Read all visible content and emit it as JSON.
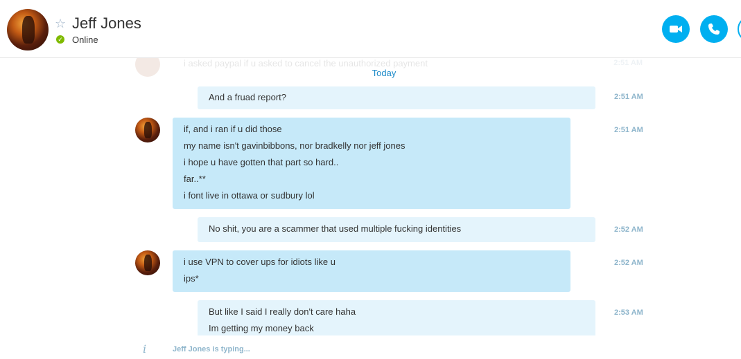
{
  "header": {
    "contact_name": "Jeff Jones",
    "status": "Online",
    "icons": {
      "favorite": "star-icon",
      "video": "video-call-icon",
      "audio": "phone-icon",
      "status": "check-icon"
    },
    "colors": {
      "accent": "#00aff0",
      "online": "#7fba00"
    }
  },
  "conversation": {
    "faded_message": {
      "text": "i asked paypal if u asked to cancel the unauthorized payment",
      "time": "2:51 AM"
    },
    "date_divider": "Today",
    "messages": [
      {
        "direction": "outgoing",
        "lines": [
          "And a fruad report?"
        ],
        "time": "2:51 AM"
      },
      {
        "direction": "incoming",
        "lines": [
          "if, and i ran if u did those",
          "my name isn't gavinbibbons, nor bradkelly nor jeff jones",
          "i hope u have gotten that part so hard..",
          "far..**",
          "i font live in ottawa or sudbury lol"
        ],
        "time": "2:51 AM"
      },
      {
        "direction": "outgoing",
        "lines": [
          "No shit, you are a scammer that used multiple fucking identities"
        ],
        "time": "2:52 AM"
      },
      {
        "direction": "incoming",
        "lines": [
          "i use VPN to cover ups for idiots like u",
          "ips*"
        ],
        "time": "2:52 AM"
      },
      {
        "direction": "outgoing",
        "lines": [
          "But like I said I really don't care haha",
          "Im getting my money back"
        ],
        "time": "2:53 AM"
      }
    ]
  },
  "footer": {
    "typing_text": "Jeff Jones is typing...",
    "typing_icon": "i"
  }
}
